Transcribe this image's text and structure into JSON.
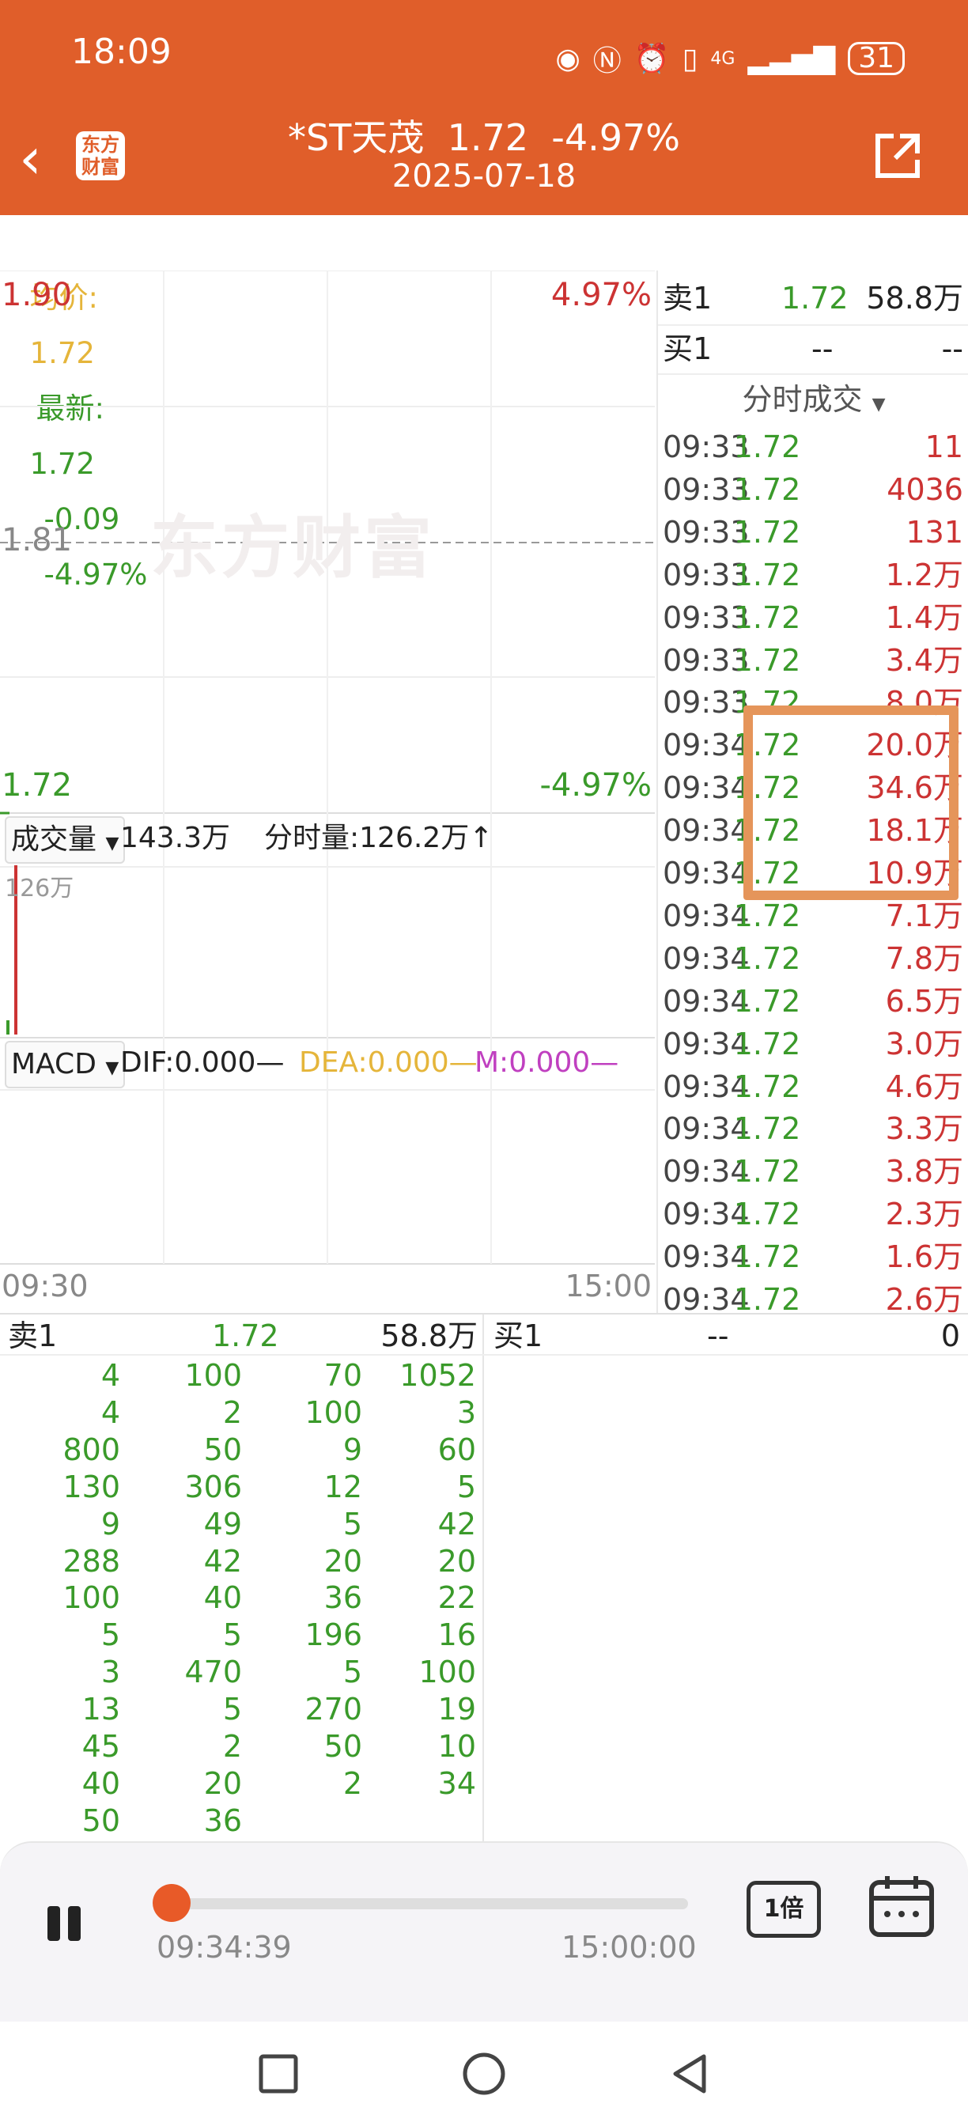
{
  "status": {
    "time": "18:09",
    "net": "4G",
    "battery": "31"
  },
  "header": {
    "logo_line1": "东方",
    "logo_line2": "财富",
    "title": "*ST天茂  1.72  -4.97%",
    "date": "2025-07-18"
  },
  "avgbar": {
    "avg_label": "均价:",
    "avg_value": "1.72",
    "latest_label": "最新:",
    "latest_value": "1.72",
    "change": "-0.09",
    "pct": "-4.97%"
  },
  "chart": {
    "price_high": "1.90",
    "pct_high": "4.97%",
    "price_mid": "1.81",
    "price_low": "1.72",
    "pct_low": "-4.97%",
    "watermark": "东方财富",
    "volume_label": "成交量",
    "volume_total": "143.3万",
    "tick_vol": "分时量:126.2万↑",
    "vol_scale": "126万",
    "macd_label": "MACD",
    "dif": "DIF:0.000—",
    "dea": "DEA:0.000—",
    "m": "M:0.000—",
    "time_start": "09:30",
    "time_end": "15:00"
  },
  "orderbook": {
    "sell_label": "卖1",
    "sell_price": "1.72",
    "sell_vol": "58.8万",
    "buy_label": "买1",
    "buy_price": "--",
    "buy_vol": "--"
  },
  "trades_title": "分时成交",
  "trades": [
    {
      "time": "09:33",
      "price": "1.72",
      "vol": "11"
    },
    {
      "time": "09:33",
      "price": "1.72",
      "vol": "4036"
    },
    {
      "time": "09:33",
      "price": "1.72",
      "vol": "131"
    },
    {
      "time": "09:33",
      "price": "1.72",
      "vol": "1.2万"
    },
    {
      "time": "09:33",
      "price": "1.72",
      "vol": "1.4万"
    },
    {
      "time": "09:33",
      "price": "1.72",
      "vol": "3.4万"
    },
    {
      "time": "09:33",
      "price": "1.72",
      "vol": "8.0万"
    },
    {
      "time": "09:34",
      "price": "1.72",
      "vol": "20.0万"
    },
    {
      "time": "09:34",
      "price": "1.72",
      "vol": "34.6万"
    },
    {
      "time": "09:34",
      "price": "1.72",
      "vol": "18.1万"
    },
    {
      "time": "09:34",
      "price": "1.72",
      "vol": "10.9万"
    },
    {
      "time": "09:34",
      "price": "1.72",
      "vol": "7.1万"
    },
    {
      "time": "09:34",
      "price": "1.72",
      "vol": "7.8万"
    },
    {
      "time": "09:34",
      "price": "1.72",
      "vol": "6.5万"
    },
    {
      "time": "09:34",
      "price": "1.72",
      "vol": "3.0万"
    },
    {
      "time": "09:34",
      "price": "1.72",
      "vol": "4.6万"
    },
    {
      "time": "09:34",
      "price": "1.72",
      "vol": "3.3万"
    },
    {
      "time": "09:34",
      "price": "1.72",
      "vol": "3.8万"
    },
    {
      "time": "09:34",
      "price": "1.72",
      "vol": "2.3万"
    },
    {
      "time": "09:34",
      "price": "1.72",
      "vol": "1.6万"
    },
    {
      "time": "09:34",
      "price": "1.72",
      "vol": "2.6万"
    }
  ],
  "queue": {
    "sell_label": "卖1",
    "sell_price": "1.72",
    "sell_vol": "58.8万",
    "buy_label": "买1",
    "buy_price": "--",
    "buy_vol": "0",
    "rows": [
      [
        "4",
        "100",
        "70",
        "1052"
      ],
      [
        "4",
        "2",
        "100",
        "3"
      ],
      [
        "800",
        "50",
        "9",
        "60"
      ],
      [
        "130",
        "306",
        "12",
        "5"
      ],
      [
        "9",
        "49",
        "5",
        "42"
      ],
      [
        "288",
        "42",
        "20",
        "20"
      ],
      [
        "100",
        "40",
        "36",
        "22"
      ],
      [
        "5",
        "5",
        "196",
        "16"
      ],
      [
        "3",
        "470",
        "5",
        "100"
      ],
      [
        "13",
        "5",
        "270",
        "19"
      ],
      [
        "45",
        "2",
        "50",
        "10"
      ],
      [
        "40",
        "20",
        "2",
        "34"
      ],
      [
        "50",
        "36",
        "",
        ""
      ]
    ]
  },
  "player": {
    "current_time": "09:34:39",
    "end_time": "15:00:00",
    "speed": "1倍",
    "progress": 0.01
  }
}
